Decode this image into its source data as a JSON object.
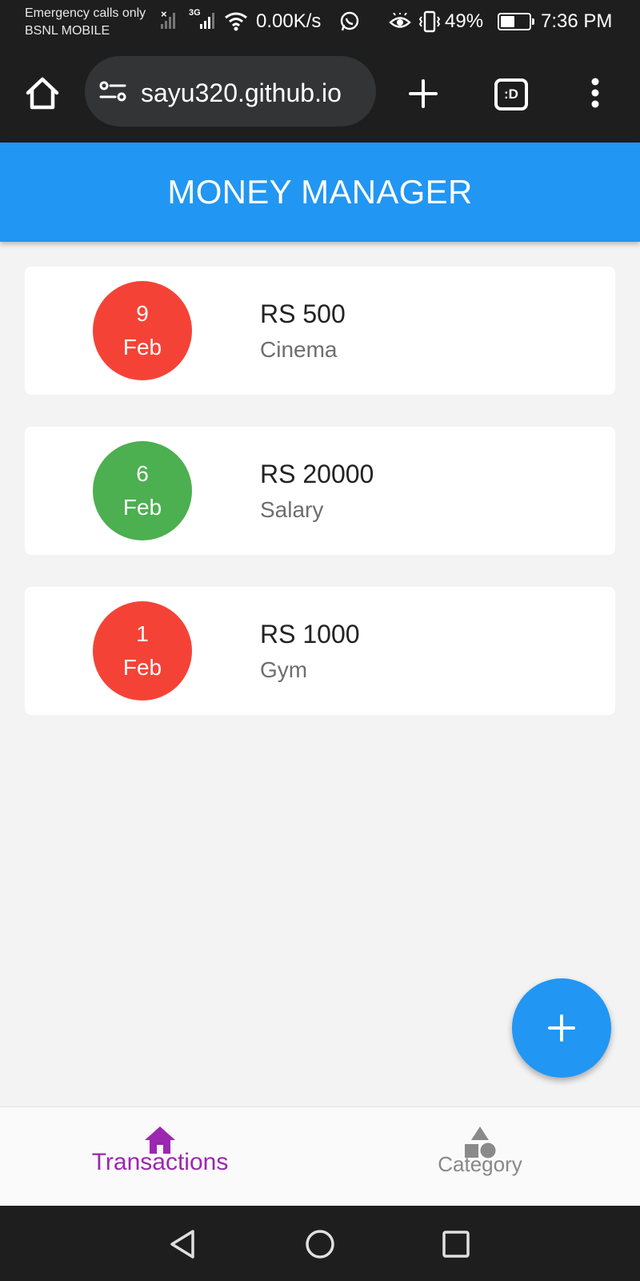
{
  "status_bar": {
    "line1": "Emergency calls only",
    "line2": "BSNL MOBILE",
    "network_type": "3G",
    "speed": "0.00K/s",
    "battery_percent": "49%",
    "battery_level": 0.49,
    "time": "7:36 PM"
  },
  "browser": {
    "url": "sayu320.github.io",
    "tab_count": ":D",
    "icons": [
      "home-icon",
      "site-settings-icon",
      "new-tab-icon",
      "tab-switcher-icon",
      "more-icon"
    ]
  },
  "app": {
    "title": "MONEY MANAGER"
  },
  "transactions": [
    {
      "day": "9",
      "month": "Feb",
      "amount": "RS 500",
      "category": "Cinema",
      "type": "expense",
      "color": "#f44336"
    },
    {
      "day": "6",
      "month": "Feb",
      "amount": "RS 20000",
      "category": "Salary",
      "type": "income",
      "color": "#4caf50"
    },
    {
      "day": "1",
      "month": "Feb",
      "amount": "RS 1000",
      "category": "Gym",
      "type": "expense",
      "color": "#f44336"
    }
  ],
  "fab": {
    "icon": "plus-icon"
  },
  "bottom_nav": {
    "items": [
      {
        "label": "Transactions",
        "icon": "home-icon",
        "active": true
      },
      {
        "label": "Category",
        "icon": "shapes-icon",
        "active": false
      }
    ]
  },
  "colors": {
    "primary": "#2196f3",
    "accent": "#9c27b0",
    "expense": "#f44336",
    "income": "#4caf50"
  }
}
